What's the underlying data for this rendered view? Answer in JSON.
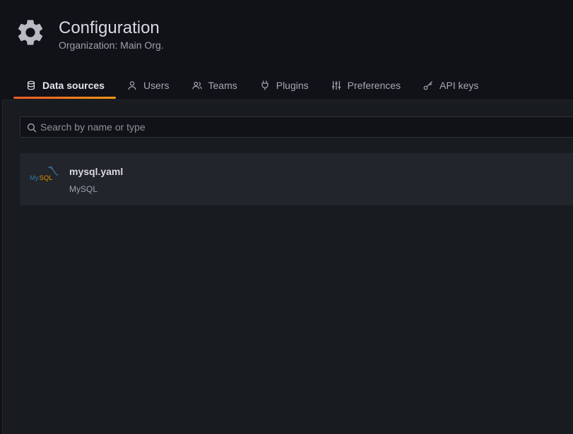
{
  "header": {
    "title": "Configuration",
    "subtitle": "Organization: Main Org.",
    "icon": "gear-icon"
  },
  "tabs": [
    {
      "label": "Data sources",
      "icon": "database-icon",
      "active": true
    },
    {
      "label": "Users",
      "icon": "user-icon",
      "active": false
    },
    {
      "label": "Teams",
      "icon": "users-icon",
      "active": false
    },
    {
      "label": "Plugins",
      "icon": "plug-icon",
      "active": false
    },
    {
      "label": "Preferences",
      "icon": "sliders-icon",
      "active": false
    },
    {
      "label": "API keys",
      "icon": "key-icon",
      "active": false
    }
  ],
  "search": {
    "placeholder": "Search by name or type",
    "value": ""
  },
  "datasources": [
    {
      "name": "mysql.yaml",
      "type": "MySQL",
      "logo": "mysql-logo"
    }
  ],
  "colors": {
    "background": "#111217",
    "panel": "#181b1f",
    "card": "#22252b",
    "accent": "#f05a28"
  }
}
